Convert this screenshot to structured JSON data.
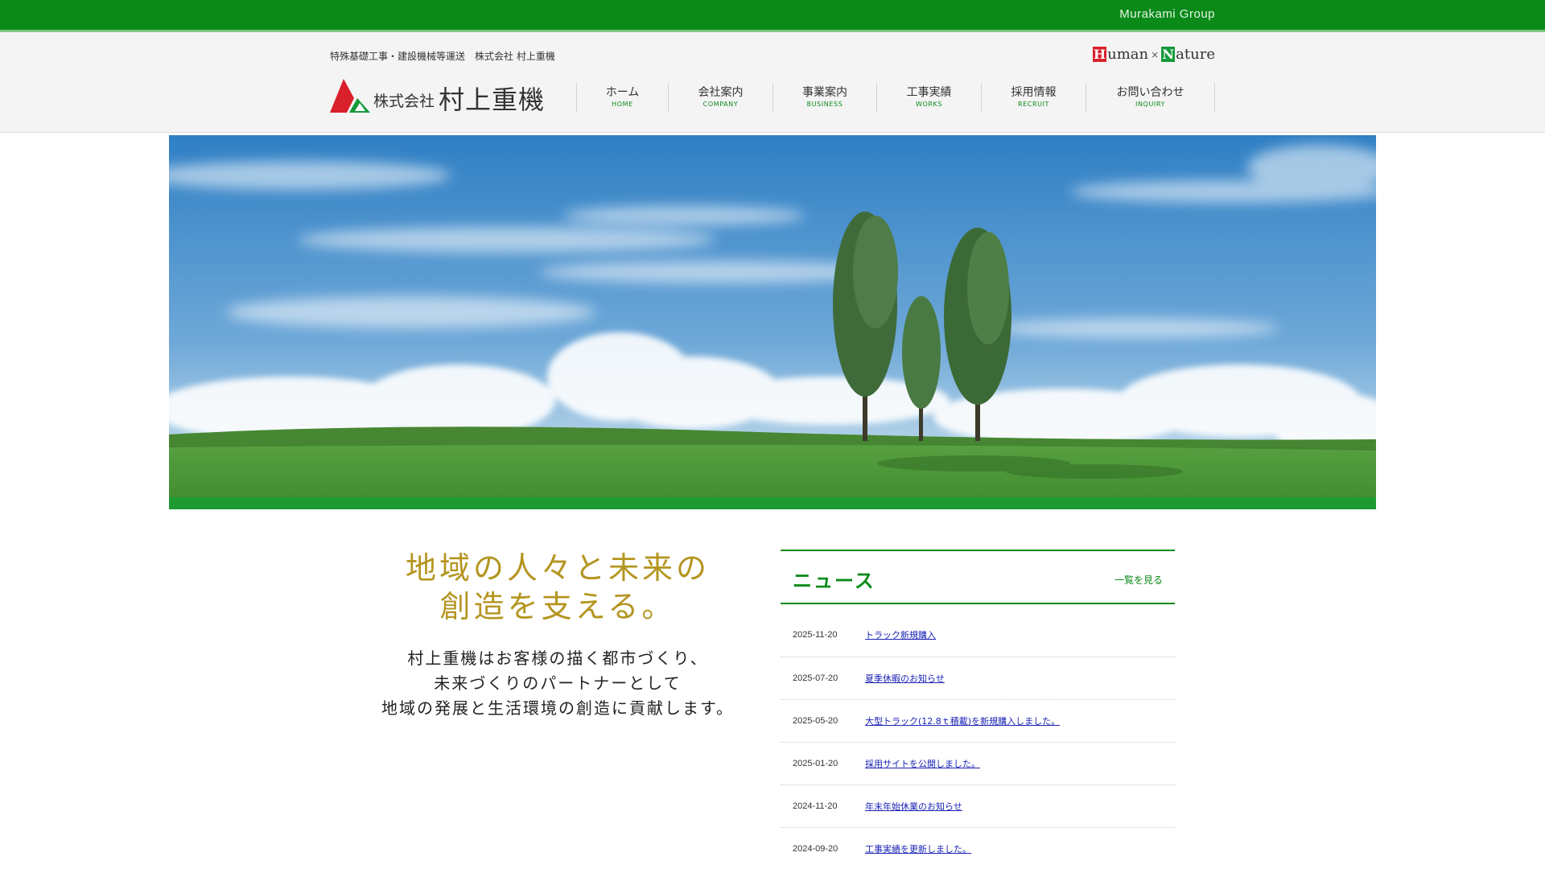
{
  "topbar": {
    "group_label": "Murakami Group"
  },
  "header": {
    "tagline": "特殊基礎工事・建設機械等運送　株式会社 村上重機",
    "slogan": {
      "h": "H",
      "human_rest": "uman",
      "times": "×",
      "n": "N",
      "nature_rest": "ature"
    },
    "logo": {
      "kabushiki": "株式会社",
      "name": "村上重機"
    }
  },
  "nav": [
    {
      "jp": "ホーム",
      "en": "HOME"
    },
    {
      "jp": "会社案内",
      "en": "COMPANY"
    },
    {
      "jp": "事業案内",
      "en": "BUSINESS"
    },
    {
      "jp": "工事実績",
      "en": "WORKS"
    },
    {
      "jp": "採用情報",
      "en": "RECRUIT"
    },
    {
      "jp": "お問い合わせ",
      "en": "INQUIRY"
    }
  ],
  "intro": {
    "catch_line1": "地域の人々と未来の",
    "catch_line2": "創造を支える。",
    "lead_line1": "村上重機はお客様の描く都市づくり、",
    "lead_line2": "未来づくりのパートナーとして",
    "lead_line3": "地域の発展と生活環境の創造に貢献します。"
  },
  "news": {
    "title": "ニュース",
    "more_label": "一覧を見る",
    "items": [
      {
        "date": "2025-11-20",
        "title": "トラック新規購入"
      },
      {
        "date": "2025-07-20",
        "title": "夏季休暇のお知らせ"
      },
      {
        "date": "2025-05-20",
        "title": "大型トラック(12.8ｔ積載)を新規購入しました。"
      },
      {
        "date": "2025-01-20",
        "title": "採用サイトを公開しました。"
      },
      {
        "date": "2024-11-20",
        "title": "年末年始休業のお知らせ"
      },
      {
        "date": "2024-09-20",
        "title": "工事実績を更新しました。"
      }
    ]
  },
  "colors": {
    "brand_green": "#0b8a19",
    "catch_gold": "#b49520",
    "link_blue": "#1a23b4",
    "logo_red": "#d9212b"
  }
}
